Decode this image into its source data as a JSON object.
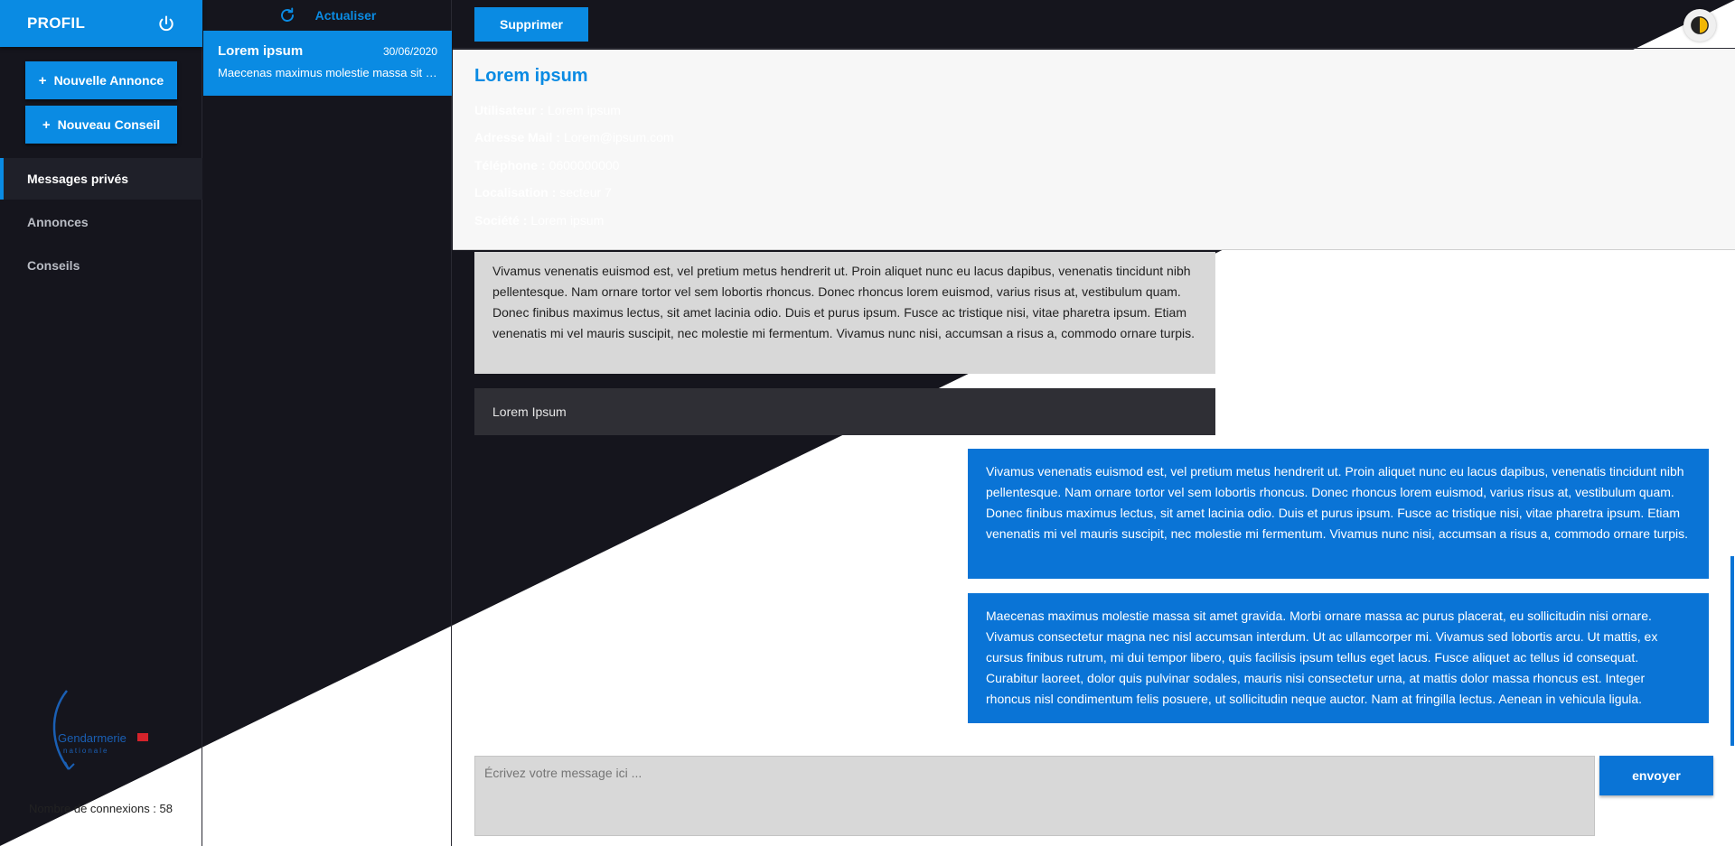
{
  "sidebar": {
    "profil_title": "PROFIL",
    "new_announcement": "Nouvelle Annonce",
    "new_advice": "Nouveau Conseil",
    "plus": "+",
    "nav": [
      {
        "label": "Messages privés"
      },
      {
        "label": "Annonces"
      },
      {
        "label": "Conseils"
      }
    ],
    "logo_text_1": "Gendarmerie",
    "logo_text_2": "nationale",
    "connexions_label": "Nombre de connexions : 58"
  },
  "conversations": {
    "refresh_label": "Actualiser",
    "items": [
      {
        "name": "Lorem ipsum",
        "date": "30/06/2020",
        "preview": "Maecenas maximus molestie massa sit amet gravida."
      }
    ]
  },
  "main": {
    "delete_label": "Supprimer",
    "contact": {
      "title": "Lorem ipsum",
      "rows": [
        {
          "label": "Utilisateur :",
          "value": "Lorem ipsum"
        },
        {
          "label": "Adresse Mail :",
          "value": "Lorem@ipsum.com"
        },
        {
          "label": "Téléphone :",
          "value": "0600000000"
        },
        {
          "label": "Localisation :",
          "value": "secteur 7"
        },
        {
          "label": "Société :",
          "value": "Lorem ipsum"
        }
      ]
    },
    "messages": [
      {
        "direction": "in",
        "text": "Vivamus venenatis euismod est, vel pretium metus hendrerit ut. Proin aliquet nunc eu lacus dapibus, venenatis tincidunt nibh pellentesque. Nam ornare tortor vel sem lobortis rhoncus. Donec rhoncus lorem euismod, varius risus at, vestibulum quam. Donec finibus maximus lectus, sit amet lacinia odio. Duis et purus ipsum. Fusce ac tristique nisi, vitae pharetra ipsum. Etiam venenatis mi vel mauris suscipit, nec molestie mi fermentum. Vivamus nunc nisi, accumsan a risus a, commodo ornare turpis."
      },
      {
        "direction": "in",
        "text": "Lorem Ipsum"
      },
      {
        "direction": "out",
        "text": "Vivamus venenatis euismod est, vel pretium metus hendrerit ut. Proin aliquet nunc eu lacus dapibus, venenatis tincidunt nibh pellentesque. Nam ornare tortor vel sem lobortis rhoncus. Donec rhoncus lorem euismod, varius risus at, vestibulum quam. Donec finibus maximus lectus, sit amet lacinia odio. Duis et purus ipsum. Fusce ac tristique nisi, vitae pharetra ipsum. Etiam venenatis mi vel mauris suscipit, nec molestie mi fermentum. Vivamus nunc nisi, accumsan a risus a, commodo ornare turpis."
      },
      {
        "direction": "out",
        "text": "Maecenas maximus molestie massa sit amet gravida. Morbi ornare massa ac purus placerat, eu sollicitudin nisi ornare. Vivamus consectetur magna nec nisl accumsan interdum. Ut ac ullamcorper mi. Vivamus sed lobortis arcu. Ut mattis, ex cursus finibus rutrum, mi dui tempor libero, quis facilisis ipsum tellus eget lacus. Fusce aliquet ac tellus id consequat. Curabitur laoreet, dolor quis pulvinar sodales, mauris nisi consectetur urna, at mattis dolor massa rhoncus est. Integer rhoncus nisl condimentum felis posuere, ut sollicitudin neque auctor. Nam at fringilla lectus. Aenean in vehicula ligula."
      }
    ],
    "composer_placeholder": "Écrivez votre message ici ...",
    "send_label": "envoyer"
  },
  "colors": {
    "accent": "#0a8be3",
    "outgoing": "#0a74d6",
    "dark_bg": "#15151d",
    "light_bg": "#f7f7f7"
  },
  "icons": {
    "power": "power-icon",
    "refresh": "refresh-icon",
    "theme": "theme-toggle-icon",
    "logo": "gendarmerie-logo"
  }
}
